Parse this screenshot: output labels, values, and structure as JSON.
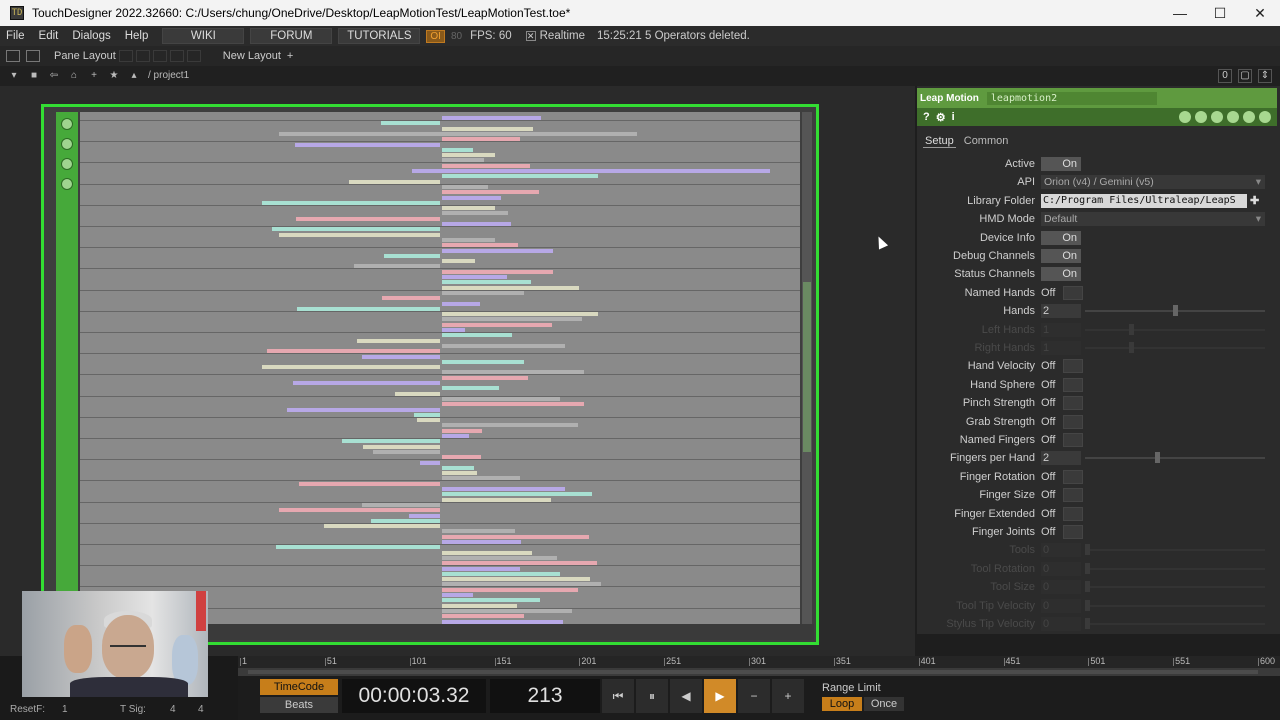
{
  "titlebar": {
    "title": "TouchDesigner 2022.32660: C:/Users/chung/OneDrive/Desktop/LeapMotionTest/LeapMotionTest.toe*",
    "icon": "touchdesigner-app-icon",
    "min": "—",
    "max": "☐",
    "close": "✕"
  },
  "menubar": {
    "items": [
      "File",
      "Edit",
      "Dialogs",
      "Help"
    ],
    "wiki": "WIKI",
    "forum": "FORUM",
    "tutorials": "TUTORIALS",
    "oi": "OI",
    "oi_num": "80",
    "fps": "FPS:  60",
    "realtime": "Realtime",
    "realtime_check": "✕",
    "status": "15:25:21 5 Operators deleted."
  },
  "panebar": {
    "pane_layout": "Pane Layout",
    "new_layout": "New Layout",
    "add": "+"
  },
  "pathbar": {
    "path": "/ project1",
    "count": "0"
  },
  "params": {
    "op_type": "Leap Motion",
    "op_name": "leapmotion2",
    "help": "?",
    "info": "i",
    "tabs": [
      "Setup",
      "Common"
    ],
    "active_tab": "Setup",
    "rows": [
      {
        "label": "Active",
        "kind": "on",
        "value": "On"
      },
      {
        "label": "API",
        "kind": "menu",
        "value": "Orion (v4) / Gemini (v5)"
      },
      {
        "label": "Library Folder",
        "kind": "text",
        "value": "C:/Program Files/Ultraleap/LeapS"
      },
      {
        "label": "HMD Mode",
        "kind": "menu",
        "value": "Default"
      },
      {
        "label": "Device Info",
        "kind": "on",
        "value": "On"
      },
      {
        "label": "Debug Channels",
        "kind": "on",
        "value": "On"
      },
      {
        "label": "Status Channels",
        "kind": "on",
        "value": "On"
      },
      {
        "label": "Named Hands",
        "kind": "off",
        "value": "Off"
      },
      {
        "label": "Hands",
        "kind": "num",
        "value": "2",
        "slider": 0.5
      },
      {
        "label": "Left Hands",
        "kind": "num",
        "value": "1",
        "slider": 0.25,
        "disabled": true
      },
      {
        "label": "Right Hands",
        "kind": "num",
        "value": "1",
        "slider": 0.25,
        "disabled": true
      },
      {
        "label": "Hand Velocity",
        "kind": "off",
        "value": "Off"
      },
      {
        "label": "Hand Sphere",
        "kind": "off",
        "value": "Off"
      },
      {
        "label": "Pinch Strength",
        "kind": "off",
        "value": "Off"
      },
      {
        "label": "Grab Strength",
        "kind": "off",
        "value": "Off"
      },
      {
        "label": "Named Fingers",
        "kind": "off",
        "value": "Off"
      },
      {
        "label": "Fingers per Hand",
        "kind": "num",
        "value": "2",
        "slider": 0.4
      },
      {
        "label": "Finger Rotation",
        "kind": "off",
        "value": "Off"
      },
      {
        "label": "Finger Size",
        "kind": "off",
        "value": "Off"
      },
      {
        "label": "Finger Extended",
        "kind": "off",
        "value": "Off"
      },
      {
        "label": "Finger Joints",
        "kind": "off",
        "value": "Off"
      },
      {
        "label": "Tools",
        "kind": "num",
        "value": "0",
        "slider": 0.0,
        "disabled": true
      },
      {
        "label": "Tool Rotation",
        "kind": "num",
        "value": "0",
        "slider": 0.0,
        "disabled": true
      },
      {
        "label": "Tool Size",
        "kind": "num",
        "value": "0",
        "slider": 0.0,
        "disabled": true
      },
      {
        "label": "Tool Tip Velocity",
        "kind": "num",
        "value": "0",
        "slider": 0.0,
        "disabled": true
      },
      {
        "label": "Stylus Tip Velocity",
        "kind": "num",
        "value": "0",
        "slider": 0.0,
        "disabled": true
      }
    ]
  },
  "timeline": {
    "ticks": [
      "1",
      "51",
      "101",
      "151",
      "201",
      "251",
      "301",
      "351",
      "401",
      "451",
      "501",
      "551",
      "600"
    ],
    "timecode": "TimeCode",
    "beats": "Beats",
    "time": "00:00:03.32",
    "frame": "213",
    "range_limit": "Range Limit",
    "loop": "Loop",
    "once": "Once",
    "reset_label": "ResetF:",
    "reset_value": "1",
    "tsig_label": "T Sig:",
    "tsig_a": "4",
    "tsig_b": "4"
  },
  "colors": {
    "accent": "#33dd33",
    "param_header": "#5f9a3f",
    "play": "#d18a28"
  }
}
